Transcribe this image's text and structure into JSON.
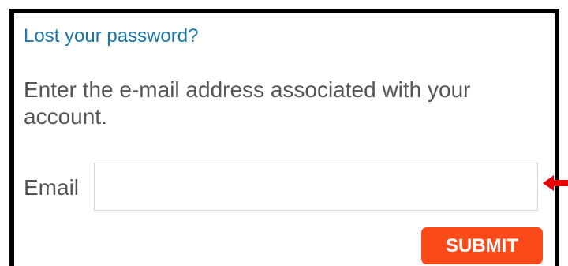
{
  "form": {
    "title": "Lost your password?",
    "description": "Enter the e-mail address associated with your account.",
    "email_label": "Email",
    "email_value": "",
    "submit_label": "SUBMIT"
  },
  "colors": {
    "title": "#1b78a8",
    "text": "#555555",
    "button": "#fc4a1a",
    "annotation_arrow": "#e60000"
  },
  "icons": {
    "annotation": "red-arrow-left-icon"
  }
}
